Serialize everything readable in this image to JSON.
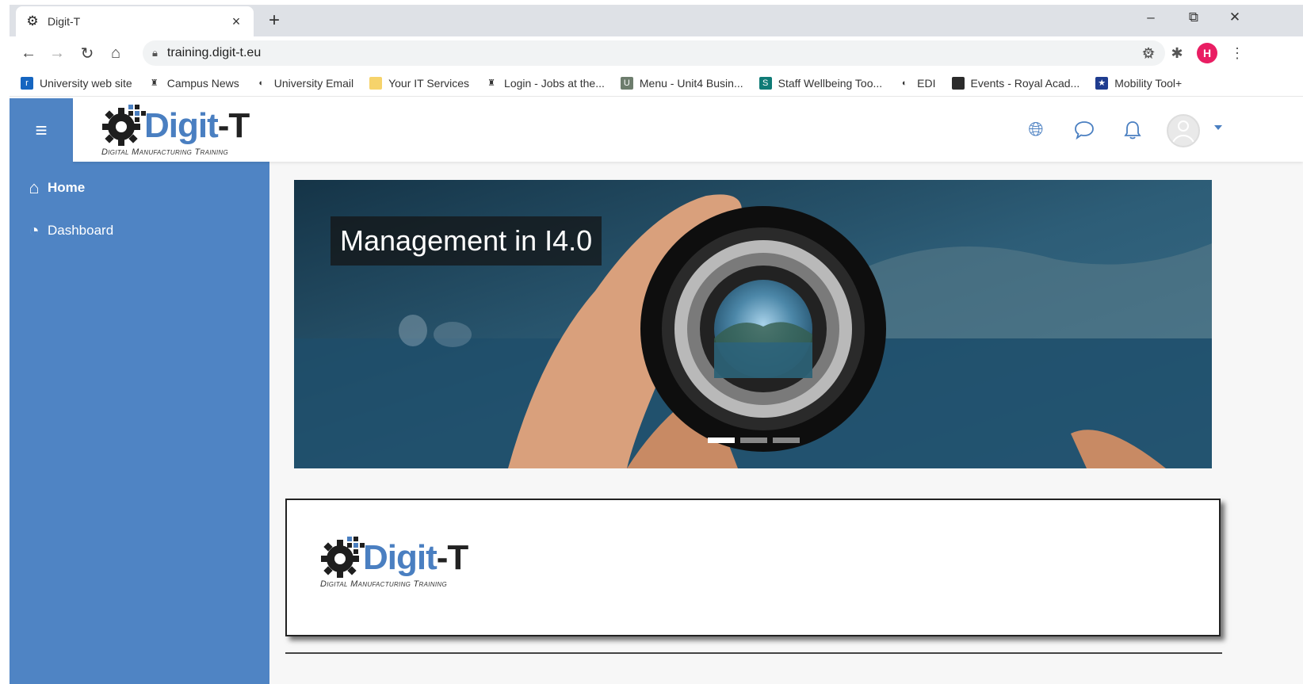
{
  "browser": {
    "tab_title": "Digit-T",
    "tab_close": "×",
    "new_tab": "+",
    "url": "training.digit-t.eu",
    "profile_initial": "H",
    "window_controls": {
      "minimize": "–",
      "restore": "⧉",
      "close": "✕"
    }
  },
  "bookmarks": [
    {
      "label": "University web site",
      "icon_color": "#1565c0",
      "icon": "r"
    },
    {
      "label": "Campus News",
      "icon_color": "#ffffff",
      "icon": "♜"
    },
    {
      "label": "University Email",
      "icon_color": "#ffffff",
      "icon": "◐"
    },
    {
      "label": "Your IT Services",
      "icon_color": "#f6d36b",
      "icon": ""
    },
    {
      "label": "Login - Jobs at the...",
      "icon_color": "#ffffff",
      "icon": "♜"
    },
    {
      "label": "Menu - Unit4 Busin...",
      "icon_color": "#6d7d6d",
      "icon": "U"
    },
    {
      "label": "Staff Wellbeing Too...",
      "icon_color": "#0f7b76",
      "icon": "S"
    },
    {
      "label": "EDI",
      "icon_color": "#ffffff",
      "icon": "◐"
    },
    {
      "label": "Events - Royal Acad...",
      "icon_color": "#2b2b2b",
      "icon": ""
    },
    {
      "label": "Mobility Tool+",
      "icon_color": "#1f3c8f",
      "icon": "★"
    }
  ],
  "site": {
    "brand_blue": "#4f84c4",
    "logo_word_blue": "Digit",
    "logo_word_dark": "-T",
    "logo_subtitle": "Digital Manufacturing Training",
    "nav": [
      {
        "label": "Home"
      },
      {
        "label": "Dashboard"
      }
    ],
    "header_icons": [
      "globe-icon",
      "message-icon",
      "bell-icon",
      "avatar",
      "caret-down-icon"
    ],
    "carousel": {
      "caption": "Management in I4.0",
      "slides": 3,
      "active_slide": 1
    }
  }
}
